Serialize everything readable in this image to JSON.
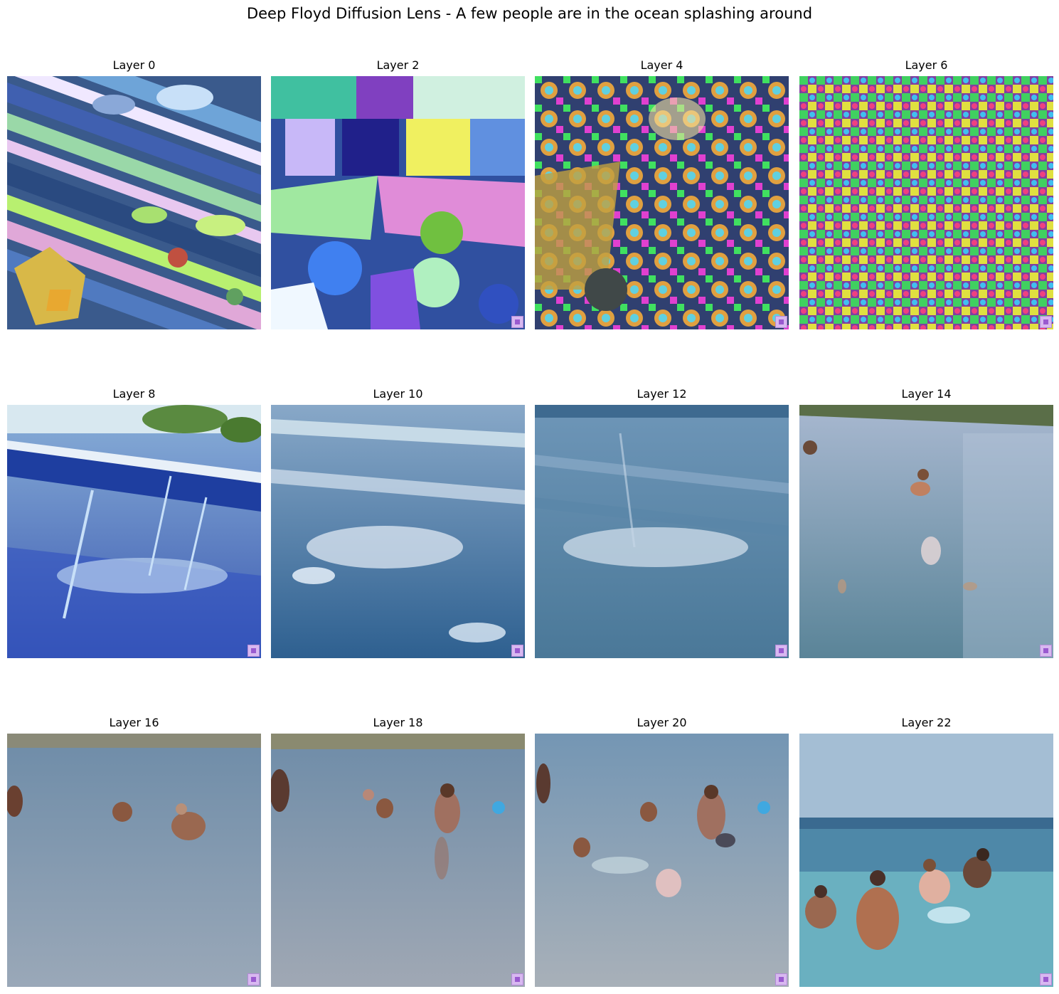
{
  "title": "Deep Floyd Diffusion Lens - A few people are in the ocean splashing around",
  "panels": [
    {
      "label": "Layer 0",
      "style": "abstract-low"
    },
    {
      "label": "Layer 2",
      "style": "abstract-mid"
    },
    {
      "label": "Layer 4",
      "style": "abstract-high"
    },
    {
      "label": "Layer 6",
      "style": "noise"
    },
    {
      "label": "Layer 8",
      "style": "pool"
    },
    {
      "label": "Layer 10",
      "style": "splash"
    },
    {
      "label": "Layer 12",
      "style": "waves"
    },
    {
      "label": "Layer 14",
      "style": "faint-people"
    },
    {
      "label": "Layer 16",
      "style": "people-a"
    },
    {
      "label": "Layer 18",
      "style": "people-b"
    },
    {
      "label": "Layer 20",
      "style": "people-c"
    },
    {
      "label": "Layer 22",
      "style": "people-d"
    }
  ],
  "watermark_icon": "purple-square-icon"
}
